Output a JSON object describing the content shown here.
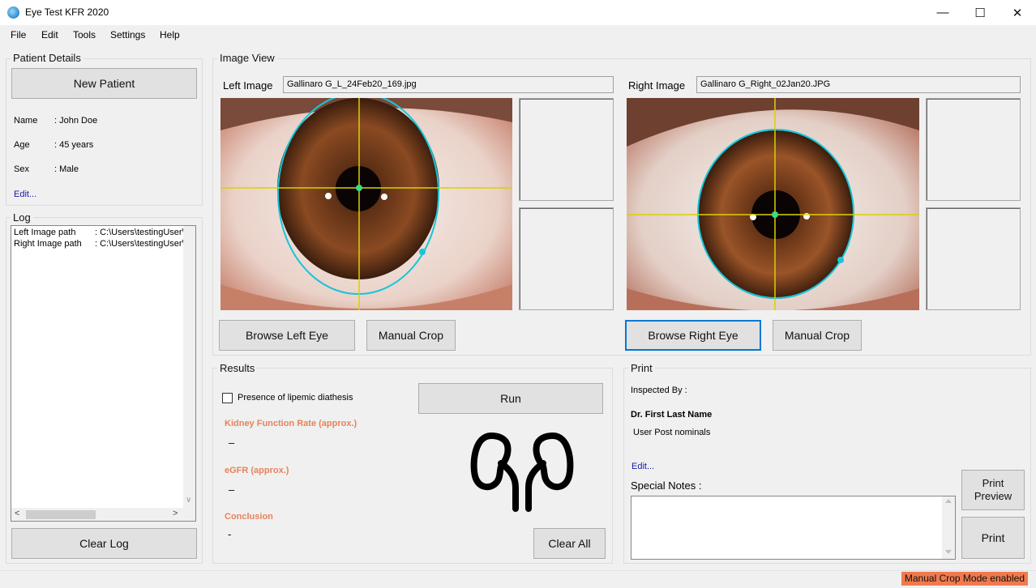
{
  "window": {
    "title": "Eye Test KFR 2020",
    "controls": {
      "minimize": "—",
      "maximize": "☐",
      "close": "✕"
    }
  },
  "menu": [
    "File",
    "Edit",
    "Tools",
    "Settings",
    "Help"
  ],
  "patient": {
    "group_title": "Patient Details",
    "new_patient": "New Patient",
    "rows": [
      {
        "label": "Name",
        "value": ": John Doe"
      },
      {
        "label": "Age",
        "value": ": 45 years"
      },
      {
        "label": "Sex",
        "value": ": Male"
      }
    ],
    "edit": "Edit..."
  },
  "log": {
    "group_title": "Log",
    "lines": [
      {
        "key": "Left Image path",
        "value": ": C:\\Users\\testingUser\\"
      },
      {
        "key": "Right Image path",
        "value": ": C:\\Users\\testingUser\\"
      }
    ],
    "scroll_left": "<",
    "scroll_right": ">",
    "scroll_down": "∨",
    "clear": "Clear Log"
  },
  "image_view": {
    "group_title": "Image View",
    "left": {
      "label": "Left Image",
      "file": "Gallinaro G_L_24Feb20_169.jpg",
      "browse": "Browse Left Eye",
      "crop": "Manual Crop"
    },
    "right": {
      "label": "Right Image",
      "file": "Gallinaro G_Right_02Jan20.JPG",
      "browse": "Browse Right Eye",
      "crop": "Manual Crop"
    }
  },
  "results": {
    "group_title": "Results",
    "checkbox": "Presence of lipemic diathesis",
    "run": "Run",
    "kfr_label": "Kidney Function Rate (approx.)",
    "kfr_value": "–",
    "egfr_label": "eGFR (approx.)",
    "egfr_value": "–",
    "conclusion_label": "Conclusion",
    "conclusion_value": "-",
    "clear_all": "Clear All"
  },
  "print": {
    "group_title": "Print",
    "inspected_by": "Inspected By :",
    "doctor": "Dr. First Last Name",
    "post_nominals": "User Post nominals",
    "edit": "Edit...",
    "notes_label": "Special Notes :",
    "preview_line1": "Print",
    "preview_line2": "Preview",
    "print": "Print"
  },
  "status": {
    "mode": "Manual Crop Mode enabled"
  },
  "colors": {
    "accent": "#0078d7",
    "warn": "#f07a4e",
    "label_orange": "#e8825a",
    "overlay_circle": "#16c6d8",
    "crosshair": "#d9d100"
  }
}
